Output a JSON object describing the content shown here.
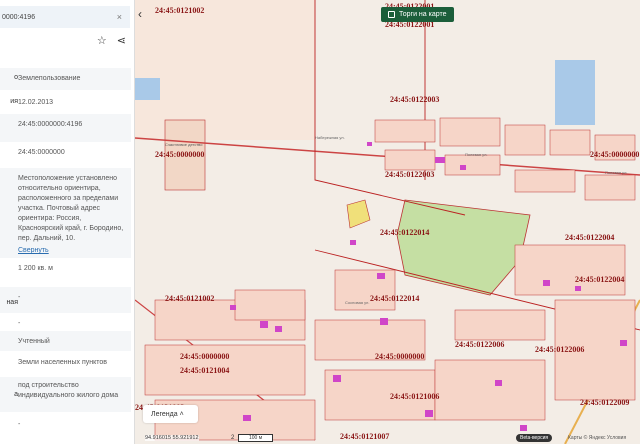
{
  "panel": {
    "search_value": "0000:4196",
    "close_icon": "×",
    "rows": [
      {
        "label": "о",
        "value": "Землепользование"
      },
      {
        "label": "ия",
        "value": "12.02.2013"
      },
      {
        "label": "",
        "value": "24:45:0000000:4196"
      },
      {
        "label": "",
        "value": "24:45:0000000"
      },
      {
        "label": "",
        "value": "Местоположение установлено относительно ориентира, расположенного за пределами участка. Почтовый адрес ориентира: Россия, Красноярский край, г. Бородино, пер. Дальний, 10."
      },
      {
        "label": "",
        "value": "1 200 кв. м"
      },
      {
        "label": "ная",
        "value": "-"
      },
      {
        "label": "",
        "value": "-"
      },
      {
        "label": "",
        "value": "Учтенный"
      },
      {
        "label": "",
        "value": "Земли населенных пунктов"
      },
      {
        "label": "а",
        "value": "под строительство индивидуального жилого дома"
      },
      {
        "label": "",
        "value": "-"
      }
    ],
    "collapse_link": "Свернуть"
  },
  "map": {
    "torgi_button": "Торги на карте",
    "legend_button": "Легенда",
    "coords": "94.916015  55.921912",
    "scale_num": "2",
    "scale_text": "100 м",
    "beta": "Beta-версия",
    "copyright": "Карты © Яндекс  Условия",
    "cad_labels": [
      "24:45:0121002",
      "24:45:0122001",
      "24:45:0122001",
      "24:45:0000000",
      "24:45:0122003",
      "24:45:0000000",
      "24:45:0122003",
      "24:45:0122014",
      "24:45:0122004",
      "24:45:0122004",
      "24:45:0121002",
      "24:45:0122014",
      "24:45:0000000",
      "24:45:0000000",
      "24:45:0122006",
      "24:45:0122006",
      "24:45:0121004",
      "24:45:0121006",
      "24:45:0122009",
      "24:45:0121003",
      "24:45:0121007"
    ],
    "streets": [
      "Набережная ул.",
      "Полевая ул.",
      "Полевая ул.",
      "Сосновая ул."
    ],
    "poi": "Счастливое детство"
  }
}
